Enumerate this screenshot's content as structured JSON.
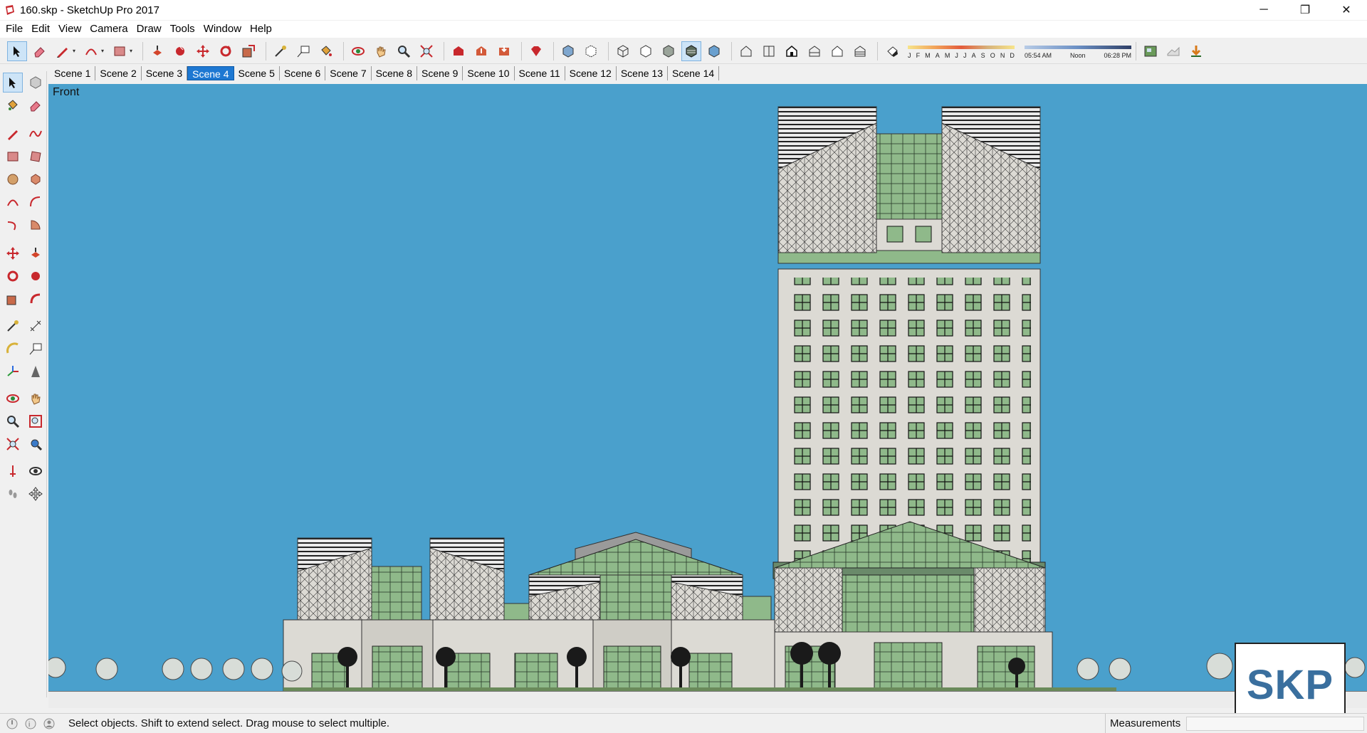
{
  "window": {
    "title": "160.skp - SketchUp Pro 2017",
    "minimize_glyph": "─",
    "restore_glyph": "❐",
    "close_glyph": "✕"
  },
  "menu": {
    "items": [
      "File",
      "Edit",
      "View",
      "Camera",
      "Draw",
      "Tools",
      "Window",
      "Help"
    ]
  },
  "toolbar": {
    "shadow_months": [
      "J",
      "F",
      "M",
      "A",
      "M",
      "J",
      "J",
      "A",
      "S",
      "O",
      "N",
      "D"
    ],
    "time_start": "05:54 AM",
    "time_mid": "Noon",
    "time_end": "06:28 PM"
  },
  "scenes": {
    "tabs": [
      "Scene 1",
      "Scene 2",
      "Scene 3",
      "Scene 4",
      "Scene 5",
      "Scene 6",
      "Scene 7",
      "Scene 8",
      "Scene 9",
      "Scene 10",
      "Scene 11",
      "Scene 12",
      "Scene 13",
      "Scene 14"
    ],
    "selected": "Scene 4"
  },
  "viewport": {
    "view_name": "Front",
    "sky_color": "#4aa0cc",
    "glass_color": "#8fb98a",
    "facade_color": "#dcdad4"
  },
  "status": {
    "hint": "Select objects. Shift to extend select. Drag mouse to select multiple.",
    "measurements_label": "Measurements",
    "measurements_value": ""
  },
  "watermark": {
    "text": "SKP"
  },
  "icons": {
    "app": "sketchup-icon",
    "accent": "#c8282d"
  }
}
